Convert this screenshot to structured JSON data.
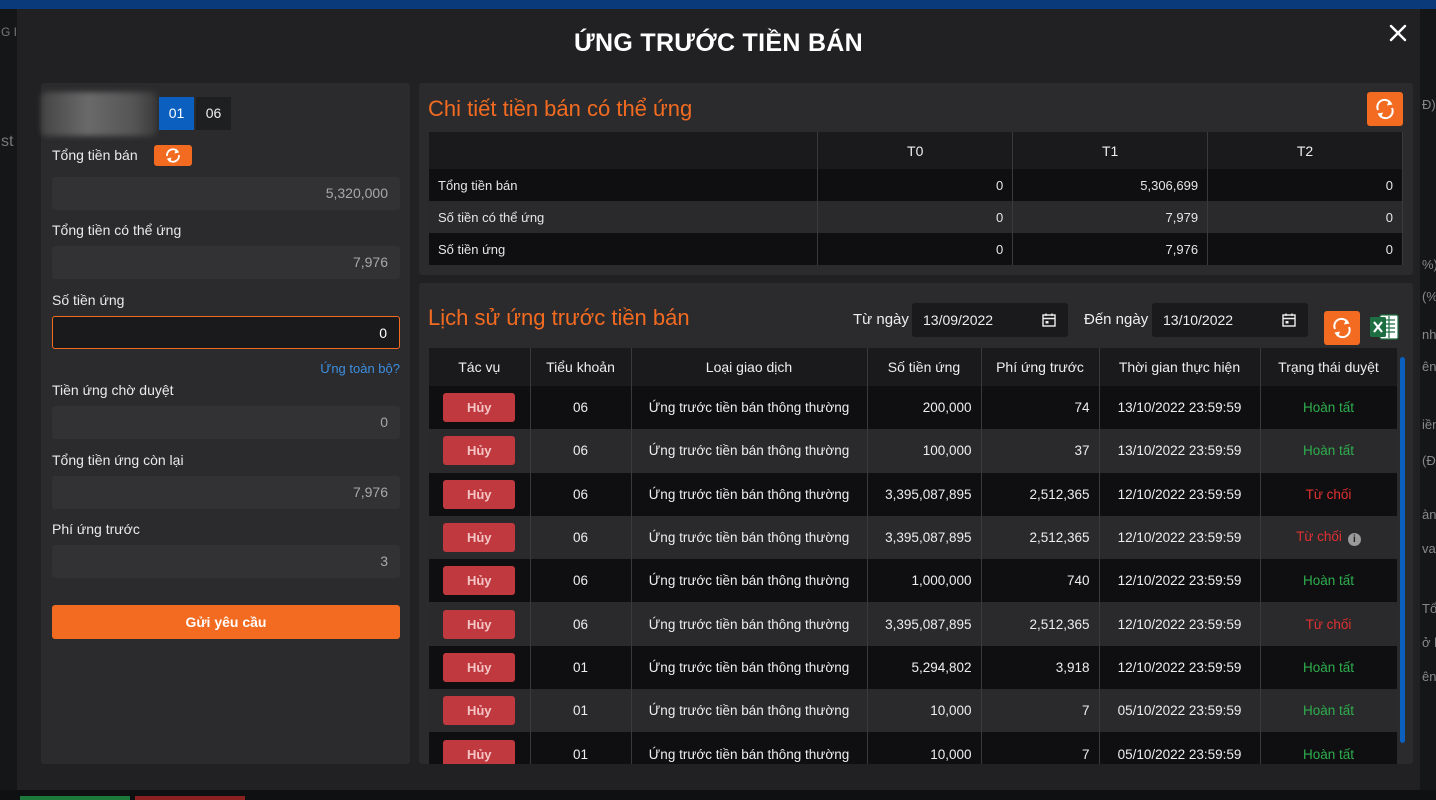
{
  "modal": {
    "title": "ỨNG TRƯỚC TIỀN BÁN"
  },
  "background": {
    "left_snippets": [
      "G I",
      "st"
    ],
    "right_snippets": [
      "Đ)",
      "%)",
      "(%)",
      "nh",
      "ên",
      "iền",
      "(Đ",
      "ành",
      "va",
      "Tổ",
      "ở h",
      "ên"
    ]
  },
  "left_panel": {
    "account_tabs": [
      "01",
      "06"
    ],
    "active_account": "01",
    "total_sale_label": "Tổng tiền bán",
    "total_sale_value": "5,320,000",
    "advance_available_label": "Tổng tiền có thể ứng",
    "advance_available_value": "7,976",
    "advance_amount_label": "Số tiền ứng",
    "advance_amount_value": "0",
    "advance_all_link": "Ứng toàn bộ?",
    "pending_label": "Tiền ứng chờ duyệt",
    "pending_value": "0",
    "remaining_label": "Tổng tiền ứng còn lại",
    "remaining_value": "7,976",
    "fee_label": "Phí ứng trước",
    "fee_value": "3",
    "submit_label": "Gửi yêu cầu"
  },
  "detail": {
    "title": "Chi tiết tiền bán có thể ứng",
    "columns": [
      "",
      "T0",
      "T1",
      "T2"
    ],
    "rows": [
      [
        "Tổng tiền bán",
        "0",
        "5,306,699",
        "0"
      ],
      [
        "Số tiền có thể ứng",
        "0",
        "7,979",
        "0"
      ],
      [
        "Số tiền ứng",
        "0",
        "7,976",
        "0"
      ]
    ]
  },
  "history": {
    "title": "Lịch sử ứng trước tiền bán",
    "from_label": "Từ ngày",
    "from_date": "13/09/2022",
    "to_label": "Đến ngày",
    "to_date": "13/10/2022",
    "columns": [
      "Tác vụ",
      "Tiểu khoản",
      "Loại giao dịch",
      "Số tiền ứng",
      "Phí ứng trước",
      "Thời gian thực hiện",
      "Trạng thái duyệt"
    ],
    "cancel_label": "Hủy",
    "rows": [
      {
        "account": "06",
        "type": "Ứng trước tiền bán thông thường",
        "amount": "200,000",
        "fee": "74",
        "time": "13/10/2022 23:59:59",
        "status": "Hoàn tất",
        "status_kind": "ok",
        "info": false
      },
      {
        "account": "06",
        "type": "Ứng trước tiền bán thông thường",
        "amount": "100,000",
        "fee": "37",
        "time": "13/10/2022 23:59:59",
        "status": "Hoàn tất",
        "status_kind": "ok",
        "info": false
      },
      {
        "account": "06",
        "type": "Ứng trước tiền bán thông thường",
        "amount": "3,395,087,895",
        "fee": "2,512,365",
        "time": "12/10/2022 23:59:59",
        "status": "Từ chối",
        "status_kind": "no",
        "info": false
      },
      {
        "account": "06",
        "type": "Ứng trước tiền bán thông thường",
        "amount": "3,395,087,895",
        "fee": "2,512,365",
        "time": "12/10/2022 23:59:59",
        "status": "Từ chối",
        "status_kind": "no",
        "info": true
      },
      {
        "account": "06",
        "type": "Ứng trước tiền bán thông thường",
        "amount": "1,000,000",
        "fee": "740",
        "time": "12/10/2022 23:59:59",
        "status": "Hoàn tất",
        "status_kind": "ok",
        "info": false
      },
      {
        "account": "06",
        "type": "Ứng trước tiền bán thông thường",
        "amount": "3,395,087,895",
        "fee": "2,512,365",
        "time": "12/10/2022 23:59:59",
        "status": "Từ chối",
        "status_kind": "no",
        "info": false
      },
      {
        "account": "01",
        "type": "Ứng trước tiền bán thông thường",
        "amount": "5,294,802",
        "fee": "3,918",
        "time": "12/10/2022 23:59:59",
        "status": "Hoàn tất",
        "status_kind": "ok",
        "info": false
      },
      {
        "account": "01",
        "type": "Ứng trước tiền bán thông thường",
        "amount": "10,000",
        "fee": "7",
        "time": "05/10/2022 23:59:59",
        "status": "Hoàn tất",
        "status_kind": "ok",
        "info": false
      },
      {
        "account": "01",
        "type": "Ứng trước tiền bán thông thường",
        "amount": "10,000",
        "fee": "7",
        "time": "05/10/2022 23:59:59",
        "status": "Hoàn tất",
        "status_kind": "ok",
        "info": false
      }
    ]
  },
  "colors": {
    "accent": "#f26b21",
    "active_tab": "#0a5fbf",
    "status_ok": "#2eae4e",
    "status_rejected": "#e03030",
    "cancel_button": "#c0393f"
  },
  "icons": {
    "close": "close-icon",
    "refresh": "refresh-icon",
    "calendar": "calendar-icon",
    "excel": "excel-export-icon",
    "info": "info-icon"
  }
}
